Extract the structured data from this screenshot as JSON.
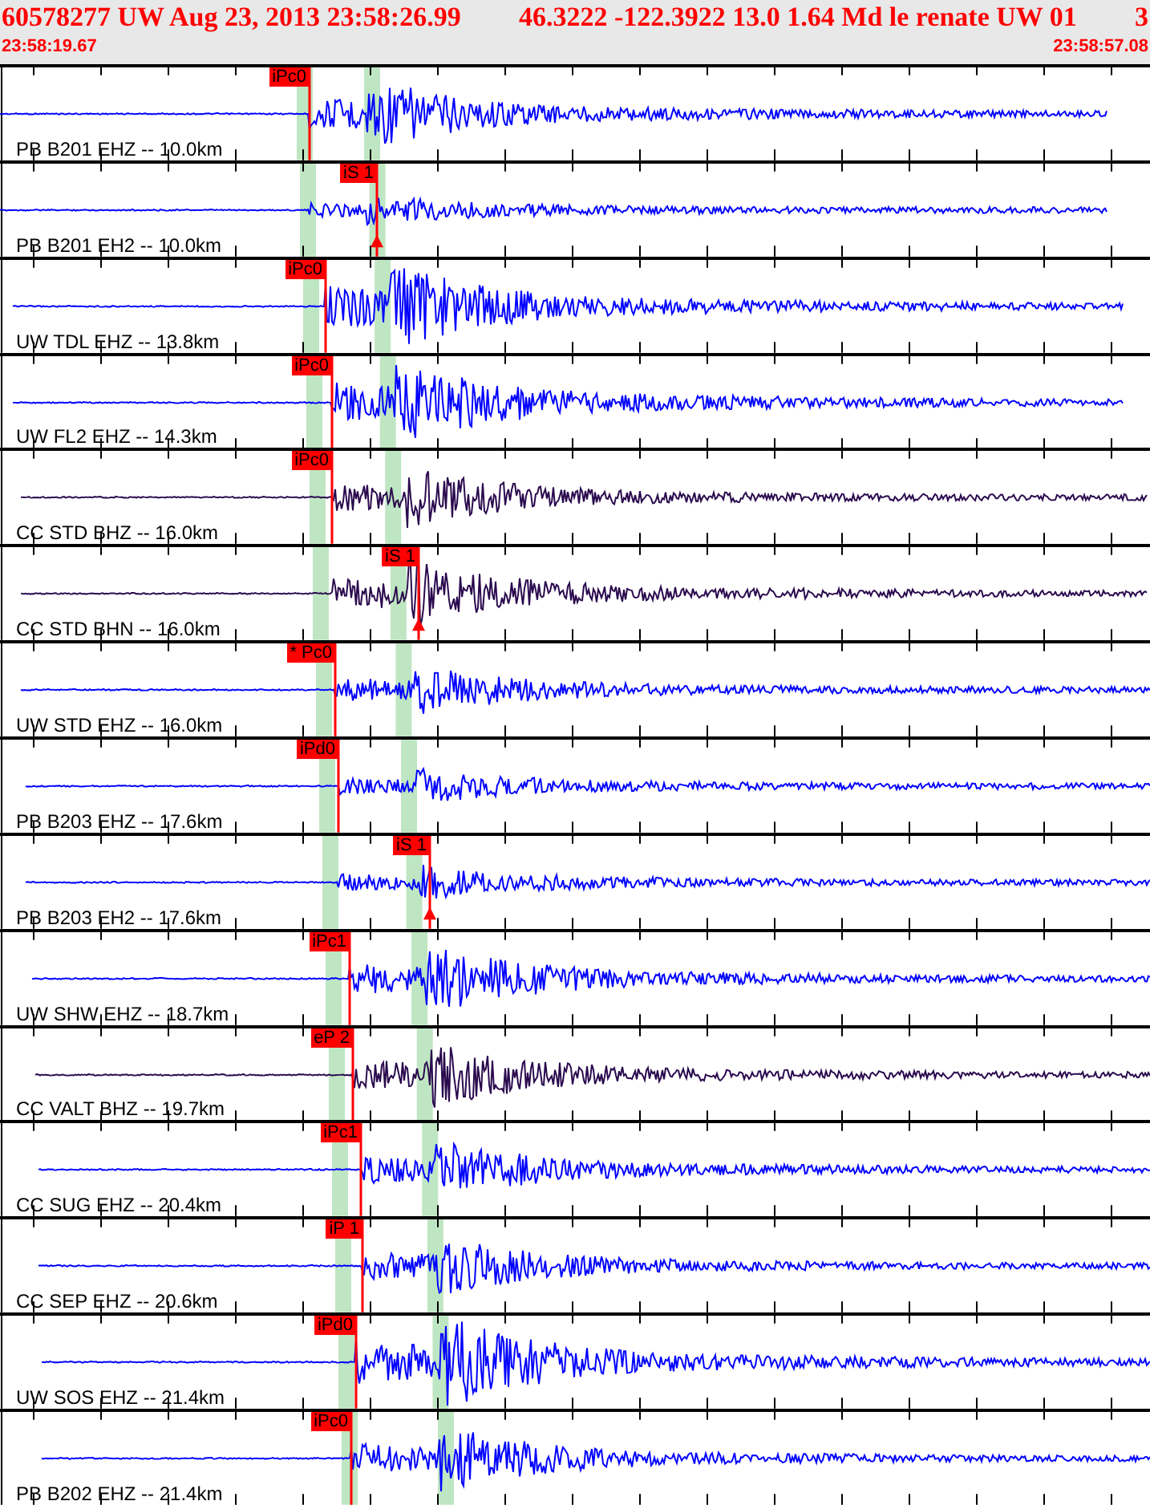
{
  "header": {
    "title_parts": [
      "60578277 UW Aug 23, 2013 23:58:26.99",
      "46.3222 -122.3922 13.0 1.64 Md le renate UW 01",
      "3"
    ],
    "start_time": "23:58:19.67",
    "end_time": "23:58:57.08"
  },
  "traces": [
    {
      "label": "PB B201 EHZ -- 10.0km",
      "pick": "iPc0",
      "kind": "P",
      "color": "#0000ff"
    },
    {
      "label": "PB B201 EH2 -- 10.0km",
      "pick": "iS 1",
      "kind": "S",
      "color": "#0000ff"
    },
    {
      "label": "UW TDL EHZ -- 13.8km",
      "pick": "iPc0",
      "kind": "P",
      "color": "#0000ff"
    },
    {
      "label": "UW FL2 EHZ -- 14.3km",
      "pick": "iPc0",
      "kind": "P",
      "color": "#0000ff"
    },
    {
      "label": "CC STD BHZ -- 16.0km",
      "pick": "iPc0",
      "kind": "P",
      "color": "#2a0a4e"
    },
    {
      "label": "CC STD BHN -- 16.0km",
      "pick": "iS 1",
      "kind": "S",
      "color": "#2a0a4e"
    },
    {
      "label": "UW STD EHZ -- 16.0km",
      "pick": "* Pc0",
      "kind": "P",
      "color": "#0000ff"
    },
    {
      "label": "PB B203 EHZ -- 17.6km",
      "pick": "iPd0",
      "kind": "P",
      "color": "#0000ff"
    },
    {
      "label": "PB B203 EH2 -- 17.6km",
      "pick": "iS 1",
      "kind": "S",
      "color": "#0000ff"
    },
    {
      "label": "UW SHW EHZ -- 18.7km",
      "pick": "iPc1",
      "kind": "P",
      "color": "#0000ff"
    },
    {
      "label": "CC VALT BHZ -- 19.7km",
      "pick": "eP 2",
      "kind": "P",
      "color": "#2a0a4e"
    },
    {
      "label": "CC SUG EHZ -- 20.4km",
      "pick": "iPc1",
      "kind": "P",
      "color": "#0000ff"
    },
    {
      "label": "CC SEP EHZ -- 20.6km",
      "pick": "iP 1",
      "kind": "P",
      "color": "#0000ff"
    },
    {
      "label": "UW SOS EHZ -- 21.4km",
      "pick": "iPd0",
      "kind": "P",
      "color": "#0000ff"
    },
    {
      "label": "PB B202 EHZ -- 21.4km",
      "pick": "iPc0",
      "kind": "P",
      "color": "#0000ff"
    }
  ]
}
